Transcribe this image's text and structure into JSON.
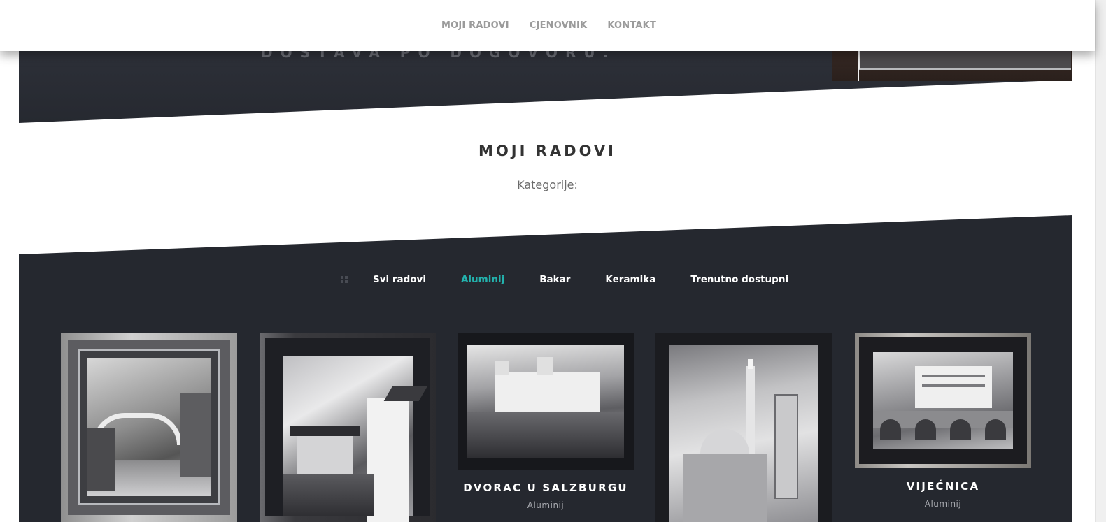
{
  "nav": {
    "items": [
      "MOJI RADOVI",
      "CJENOVNIK",
      "KONTAKT"
    ]
  },
  "hero": {
    "tagline": "DOSTAVA PO DOGOVORU."
  },
  "section": {
    "title": "MOJI RADOVI",
    "subtitle": "Kategorije:"
  },
  "filters": {
    "items": [
      "Svi radovi",
      "Aluminij",
      "Bakar",
      "Keramika",
      "Trenutno dostupni"
    ],
    "active": "Aluminij",
    "icon": "grid-icon"
  },
  "gallery": {
    "cards": [
      {
        "title": "",
        "category": ""
      },
      {
        "title": "",
        "category": ""
      },
      {
        "title": "DVORAC U SALZBURGU",
        "category": "Aluminij"
      },
      {
        "title": "",
        "category": ""
      },
      {
        "title": "VIJEĆNICA",
        "category": "Aluminij"
      }
    ]
  },
  "colors": {
    "accent": "#23b2ad",
    "dark_bg": "#25282f",
    "nav_text": "#9b9b9b"
  }
}
